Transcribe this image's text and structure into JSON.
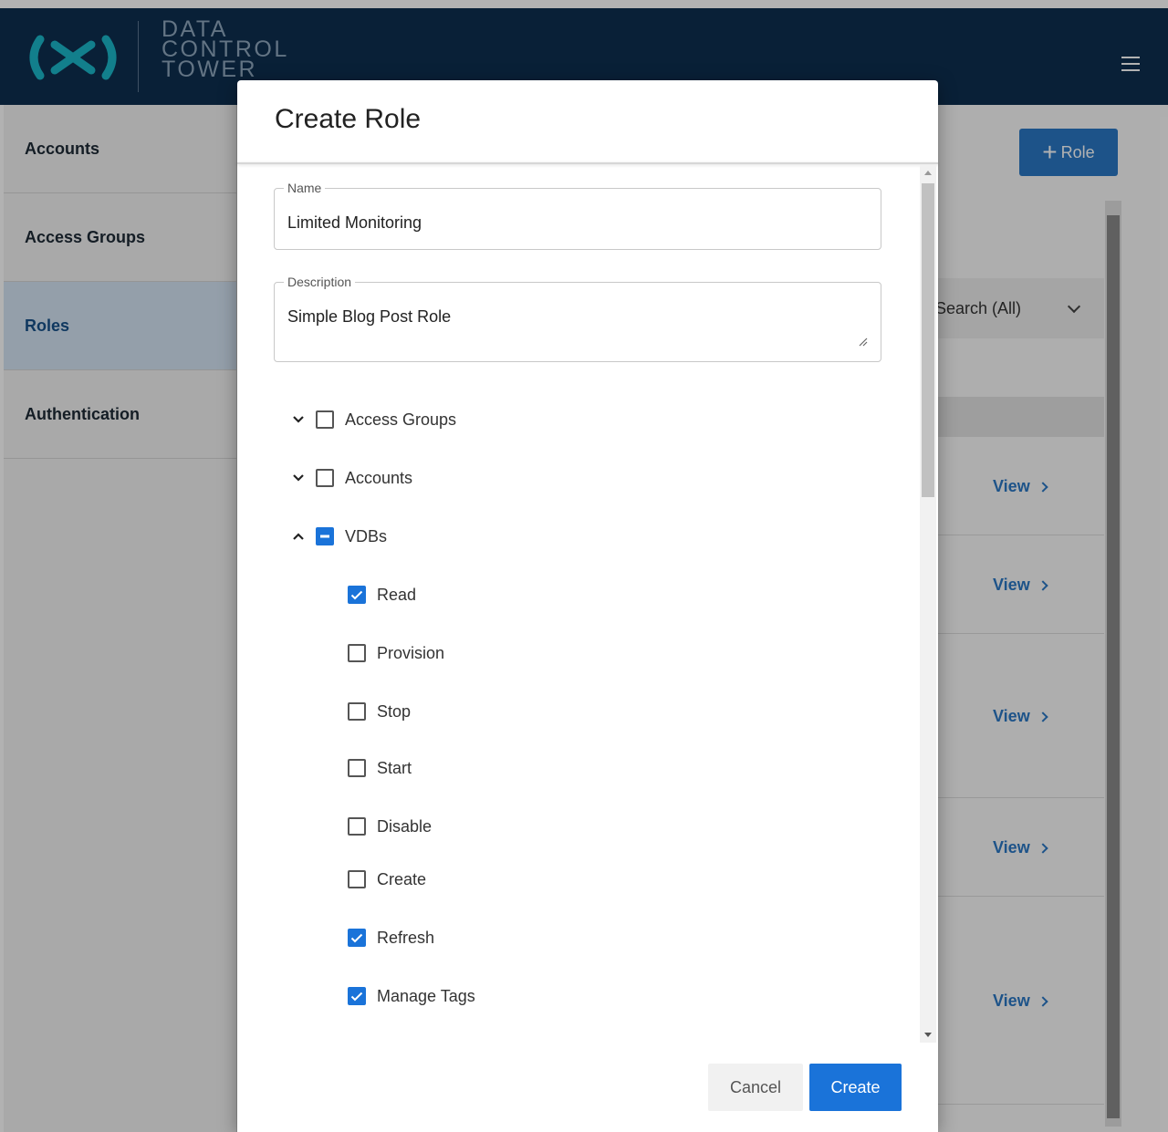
{
  "brand": {
    "logo_lines": [
      "DATA",
      "CONTROL",
      "TOWER"
    ],
    "color_primary": "#0d2e4f",
    "color_accent": "#1a73d9"
  },
  "sidebar": {
    "items": [
      {
        "label": "Accounts",
        "active": false
      },
      {
        "label": "Access Groups",
        "active": false
      },
      {
        "label": "Roles",
        "active": true
      },
      {
        "label": "Authentication",
        "active": false
      }
    ]
  },
  "main": {
    "add_role_label": "Role",
    "search_filter": "Search (All)",
    "view_label": "View"
  },
  "modal": {
    "title": "Create Role",
    "name_label": "Name",
    "name_value": "Limited Monitoring",
    "description_label": "Description",
    "description_value": "Simple Blog Post Role",
    "tree": [
      {
        "label": "Access Groups",
        "expanded": false,
        "state": "unchecked"
      },
      {
        "label": "Accounts",
        "expanded": false,
        "state": "unchecked"
      },
      {
        "label": "VDBs",
        "expanded": true,
        "state": "partial",
        "children": [
          {
            "label": "Read",
            "checked": true
          },
          {
            "label": "Provision",
            "checked": false
          },
          {
            "label": "Stop",
            "checked": false
          },
          {
            "label": "Start",
            "checked": false
          },
          {
            "label": "Disable",
            "checked": false
          },
          {
            "label": "Create",
            "checked": false
          },
          {
            "label": "Refresh",
            "checked": true
          },
          {
            "label": "Manage Tags",
            "checked": true
          }
        ]
      }
    ],
    "cancel_label": "Cancel",
    "create_label": "Create"
  }
}
